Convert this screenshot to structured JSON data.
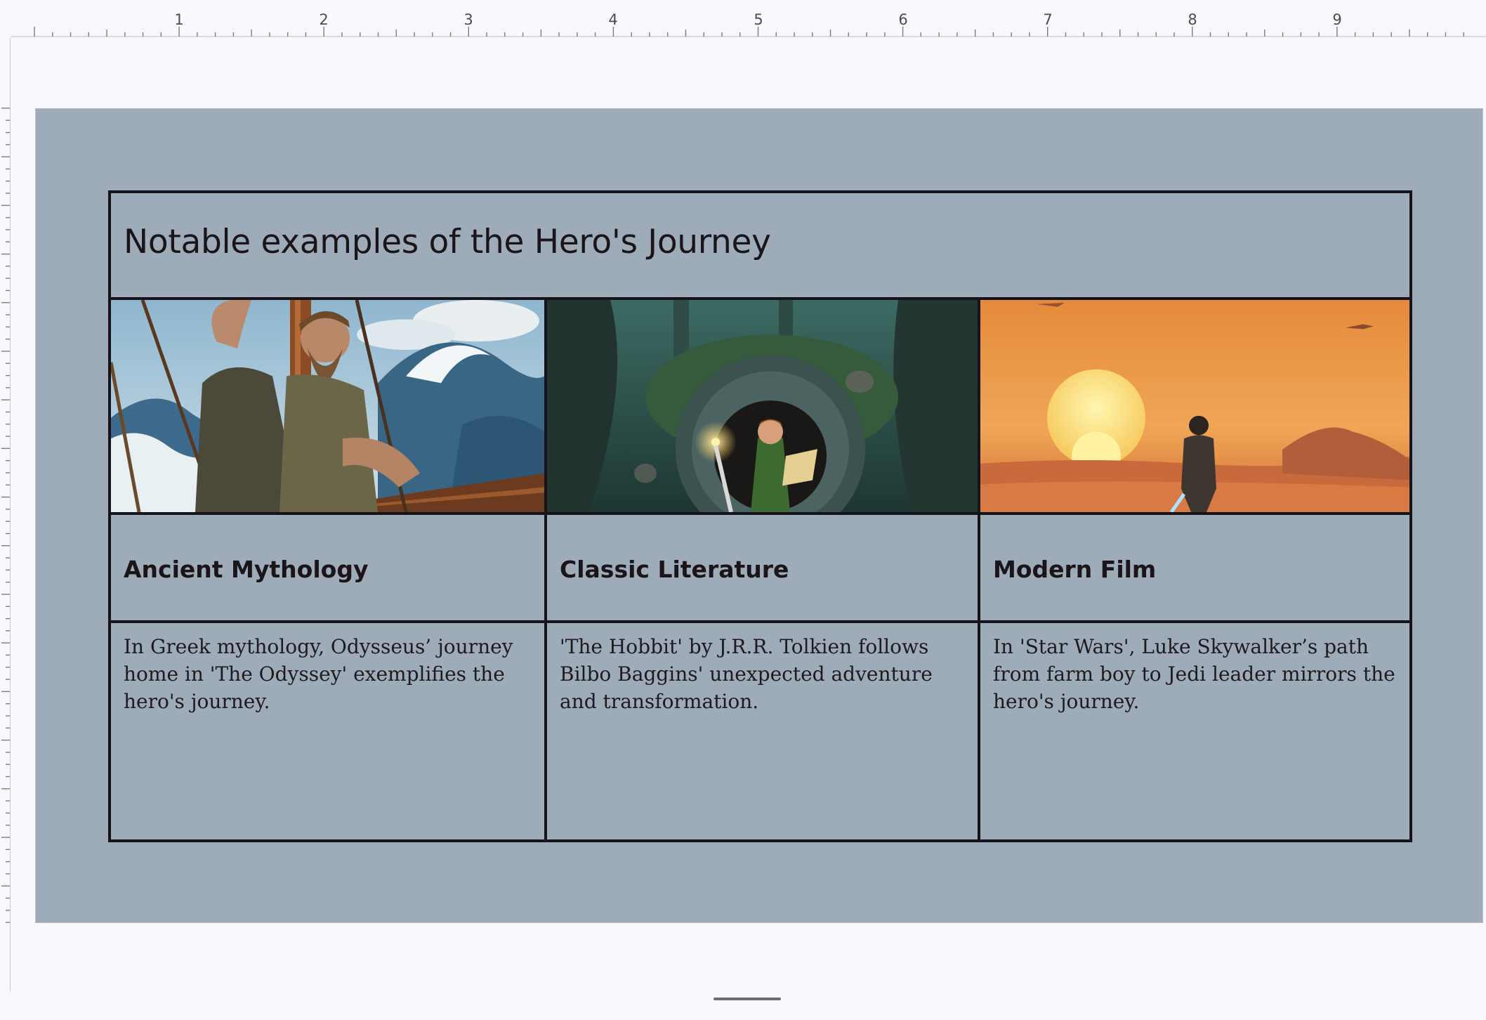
{
  "ruler": {
    "numbers": [
      "1",
      "2",
      "3",
      "4",
      "5",
      "6",
      "7",
      "8",
      "9"
    ]
  },
  "slide": {
    "title": "Notable examples of the Hero's Journey",
    "columns": [
      {
        "heading": "Ancient Mythology",
        "body": "In Greek mythology, Odysseus’ journey home in 'The Odyssey' exemplifies the hero's journey.",
        "image": "odysseus-on-ship-in-storm"
      },
      {
        "heading": "Classic Literature",
        "body": "'The Hobbit' by J.R.R. Tolkien follows Bilbo Baggins' unexpected adventure and transformation.",
        "image": "hobbit-at-round-door-in-forest"
      },
      {
        "heading": "Modern Film",
        "body": "In 'Star Wars', Luke Skywalker’s path from farm boy to Jedi leader mirrors the hero's journey.",
        "image": "figure-watching-twin-suns"
      }
    ]
  }
}
